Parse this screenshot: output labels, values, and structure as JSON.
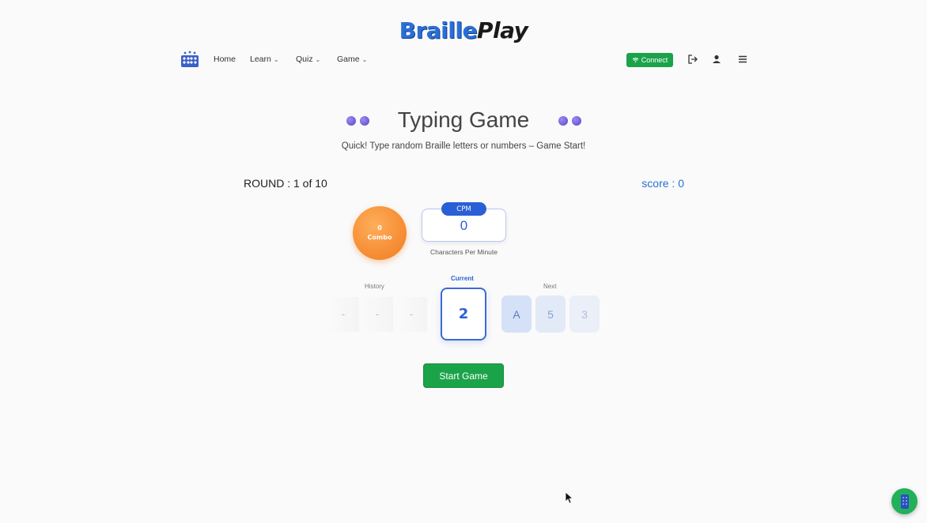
{
  "logo": {
    "part1": "Braille",
    "part2": "Play"
  },
  "nav": {
    "home": "Home",
    "learn": "Learn",
    "quiz": "Quiz",
    "game": "Game",
    "connect": "Connect"
  },
  "icons": {
    "brand": "braille-cells-icon",
    "wifi": "wifi-icon",
    "logout": "logout-icon",
    "user": "user-icon",
    "menu": "hamburger-menu-icon",
    "chat": "braille-device-icon"
  },
  "title": "Typing Game",
  "subtitle": "Quick! Type random Braille letters or numbers – Game Start!",
  "round": "ROUND : 1 of 10",
  "score": "score : 0",
  "combo": {
    "value": "0",
    "label": "Combo"
  },
  "cpm": {
    "tag": "CPM",
    "value": "0",
    "caption": "Characters Per Minute"
  },
  "letters": {
    "history_label": "History",
    "current_label": "Current",
    "next_label": "Next",
    "history": [
      "-",
      "-",
      "-"
    ],
    "current": "2",
    "next": [
      "A",
      "5",
      "3"
    ]
  },
  "start_button": "Start Game",
  "colors": {
    "accent": "#2a5fd6",
    "green": "#1ba34a",
    "orange": "#f07a1f"
  }
}
